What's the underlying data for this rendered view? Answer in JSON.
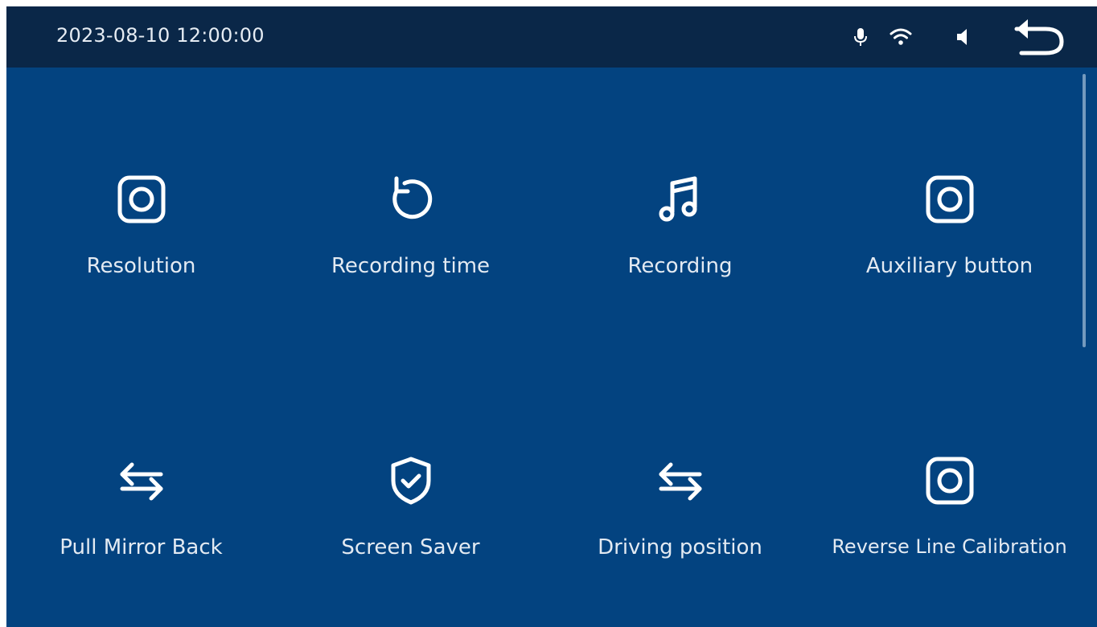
{
  "header": {
    "datetime": "2023-08-10 12:00:00",
    "status_icons": [
      "microphone-icon",
      "wifi-icon",
      "speaker-icon"
    ],
    "back_icon": "back-arrow-icon"
  },
  "menu": {
    "items": [
      {
        "label": "Resolution",
        "icon": "camera-icon"
      },
      {
        "label": "Recording time",
        "icon": "rotate-icon"
      },
      {
        "label": "Recording",
        "icon": "music-note-icon"
      },
      {
        "label": "Auxiliary button",
        "icon": "camera-icon"
      },
      {
        "label": "Pull Mirror Back",
        "icon": "swap-arrows-icon"
      },
      {
        "label": "Screen Saver",
        "icon": "shield-check-icon"
      },
      {
        "label": "Driving position",
        "icon": "swap-arrows-icon"
      },
      {
        "label": "Reverse Line Calibration",
        "icon": "camera-icon"
      }
    ]
  },
  "colors": {
    "background": "#034380",
    "topbar": "#0a2748",
    "text": "#e3eaf2"
  }
}
